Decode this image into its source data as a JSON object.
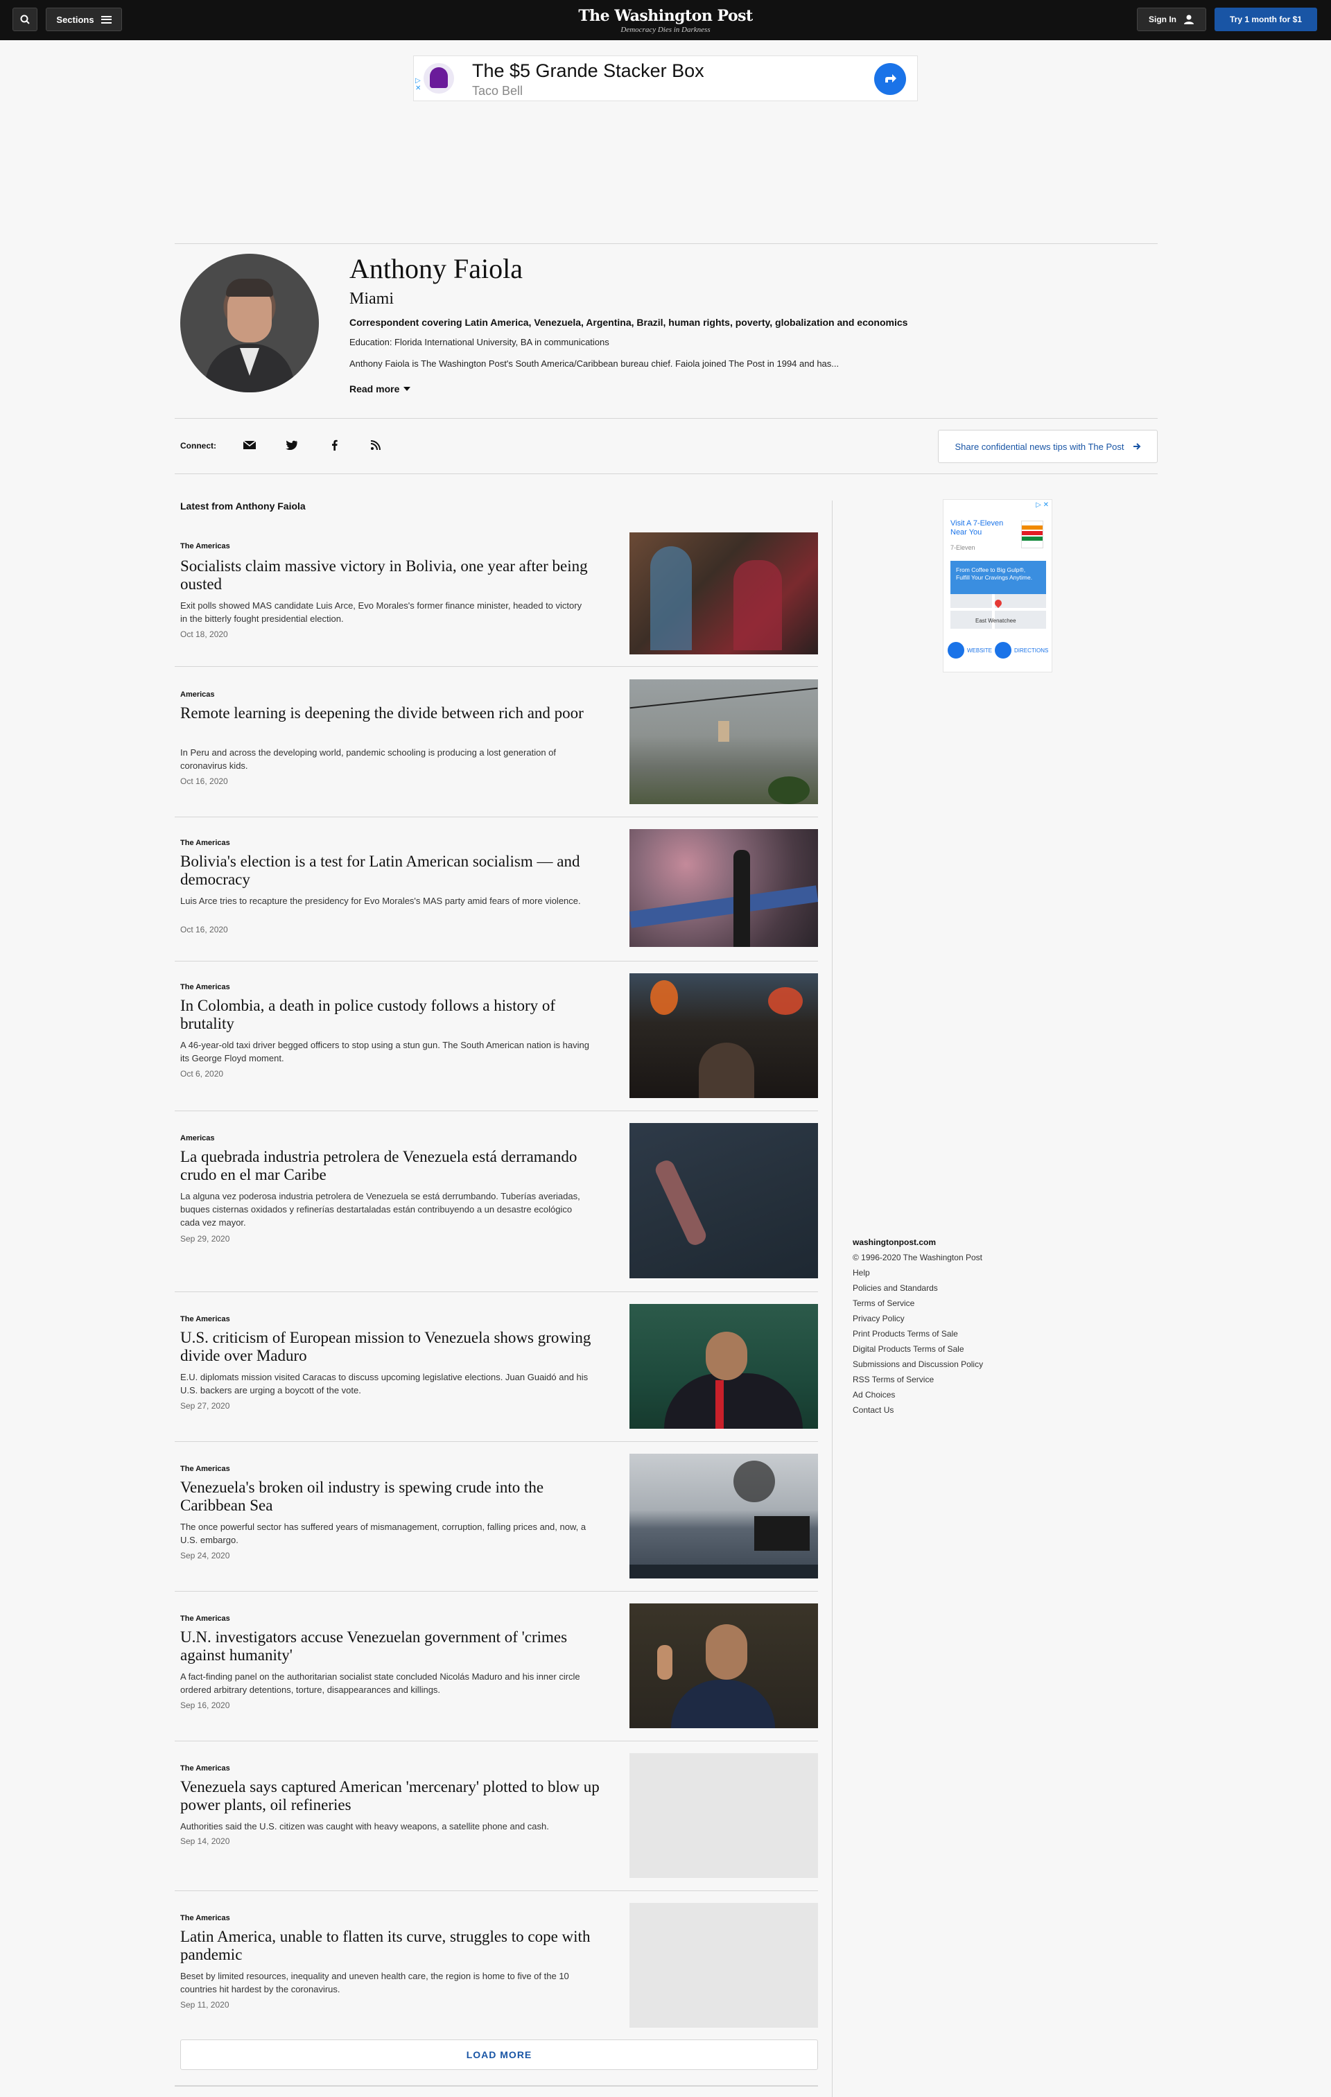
{
  "nav": {
    "sections_label": "Sections",
    "logo": "The Washington Post",
    "tagline": "Democracy Dies in Darkness",
    "signin_label": "Sign In",
    "subscribe_label": "Try 1 month for $1"
  },
  "ad_top": {
    "title": "The $5 Grande Stacker Box",
    "advertiser": "Taco Bell"
  },
  "profile": {
    "name": "Anthony Faiola",
    "location": "Miami",
    "expertise": "Correspondent covering Latin America, Venezuela, Argentina, Brazil, human rights, poverty, globalization and economics",
    "education": "Education: Florida International University, BA in communications",
    "bio": "Anthony Faiola is The Washington Post's South America/Caribbean bureau chief. Faiola joined The Post in 1994 and has...",
    "read_more": "Read more"
  },
  "connect": {
    "label": "Connect:",
    "tips_label": "Share confidential news tips with The Post"
  },
  "latest_label": "Latest from Anthony Faiola",
  "articles": [
    {
      "kicker": "The Americas",
      "headline": "Socialists claim massive victory in Bolivia, one year after being ousted",
      "blurb": "Exit polls showed MAS candidate Luis Arce, Evo Morales's former finance minister, headed to victory in the bitterly fought presidential election.",
      "date": "Oct 18, 2020"
    },
    {
      "kicker": "Americas",
      "headline": "Remote learning is deepening the divide between rich and poor",
      "blurb": "In Peru and across the developing world, pandemic schooling is producing a lost generation of coronavirus kids.",
      "date": "Oct 16, 2020"
    },
    {
      "kicker": "The Americas",
      "headline": "Bolivia's election is a test for Latin American socialism — and democracy",
      "blurb": "Luis Arce tries to recapture the presidency for Evo Morales's MAS party amid fears of more violence.",
      "date": "Oct 16, 2020"
    },
    {
      "kicker": "The Americas",
      "headline": "In Colombia, a death in police custody follows a history of brutality",
      "blurb": "A 46-year-old taxi driver begged officers to stop using a stun gun. The South American nation is having its George Floyd moment.",
      "date": "Oct 6, 2020"
    },
    {
      "kicker": "Americas",
      "headline": "La quebrada industria petrolera de Venezuela está derramando crudo en el mar Caribe",
      "blurb": "La alguna vez poderosa industria petrolera de Venezuela se está derrumbando. Tuberías averiadas, buques cisternas oxidados y refinerías destartaladas están contribuyendo a un desastre ecológico cada vez mayor.",
      "date": "Sep 29, 2020"
    },
    {
      "kicker": "The Americas",
      "headline": "U.S. criticism of European mission to Venezuela shows growing divide over Maduro",
      "blurb": "E.U. diplomats mission visited Caracas to discuss upcoming legislative elections. Juan Guaidó and his U.S. backers are urging a boycott of the vote.",
      "date": "Sep 27, 2020"
    },
    {
      "kicker": "The Americas",
      "headline": "Venezuela's broken oil industry is spewing crude into the Caribbean Sea",
      "blurb": "The once powerful sector has suffered years of mismanagement, corruption, falling prices and, now, a U.S. embargo.",
      "date": "Sep 24, 2020"
    },
    {
      "kicker": "The Americas",
      "headline": "U.N. investigators accuse Venezuelan government of 'crimes against humanity'",
      "blurb": "A fact-finding panel on the authoritarian socialist state concluded Nicolás Maduro and his inner circle ordered arbitrary detentions, torture, disappearances and killings.",
      "date": "Sep 16, 2020"
    },
    {
      "kicker": "The Americas",
      "headline": "Venezuela says captured American 'mercenary' plotted to blow up power plants, oil refineries",
      "blurb": "Authorities said the U.S. citizen was caught with heavy weapons, a satellite phone and cash.",
      "date": "Sep 14, 2020"
    },
    {
      "kicker": "The Americas",
      "headline": "Latin America, unable to flatten its curve, struggles to cope with pandemic",
      "blurb": "Beset by limited resources, inequality and uneven health care, the region is home to five of the 10 countries hit hardest by the coronavirus.",
      "date": "Sep 11, 2020"
    }
  ],
  "load_more": "LOAD MORE",
  "ad_side": {
    "headline": "Visit A 7-Eleven Near You",
    "brand": "7-Eleven",
    "promo": "From Coffee to Big Gulp®, Fulfill Your Cravings Anytime.",
    "map_label": "East Wenatchee",
    "cta_website": "WEBSITE",
    "cta_directions": "DIRECTIONS"
  },
  "footer": {
    "site": "washingtonpost.com",
    "copyright": "© 1996-2020 The Washington Post",
    "links": [
      "Help",
      "Policies and Standards",
      "Terms of Service",
      "Privacy Policy",
      "Print Products Terms of Sale",
      "Digital Products Terms of Sale",
      "Submissions and Discussion Policy",
      "RSS Terms of Service",
      "Ad Choices",
      "Contact Us"
    ]
  }
}
